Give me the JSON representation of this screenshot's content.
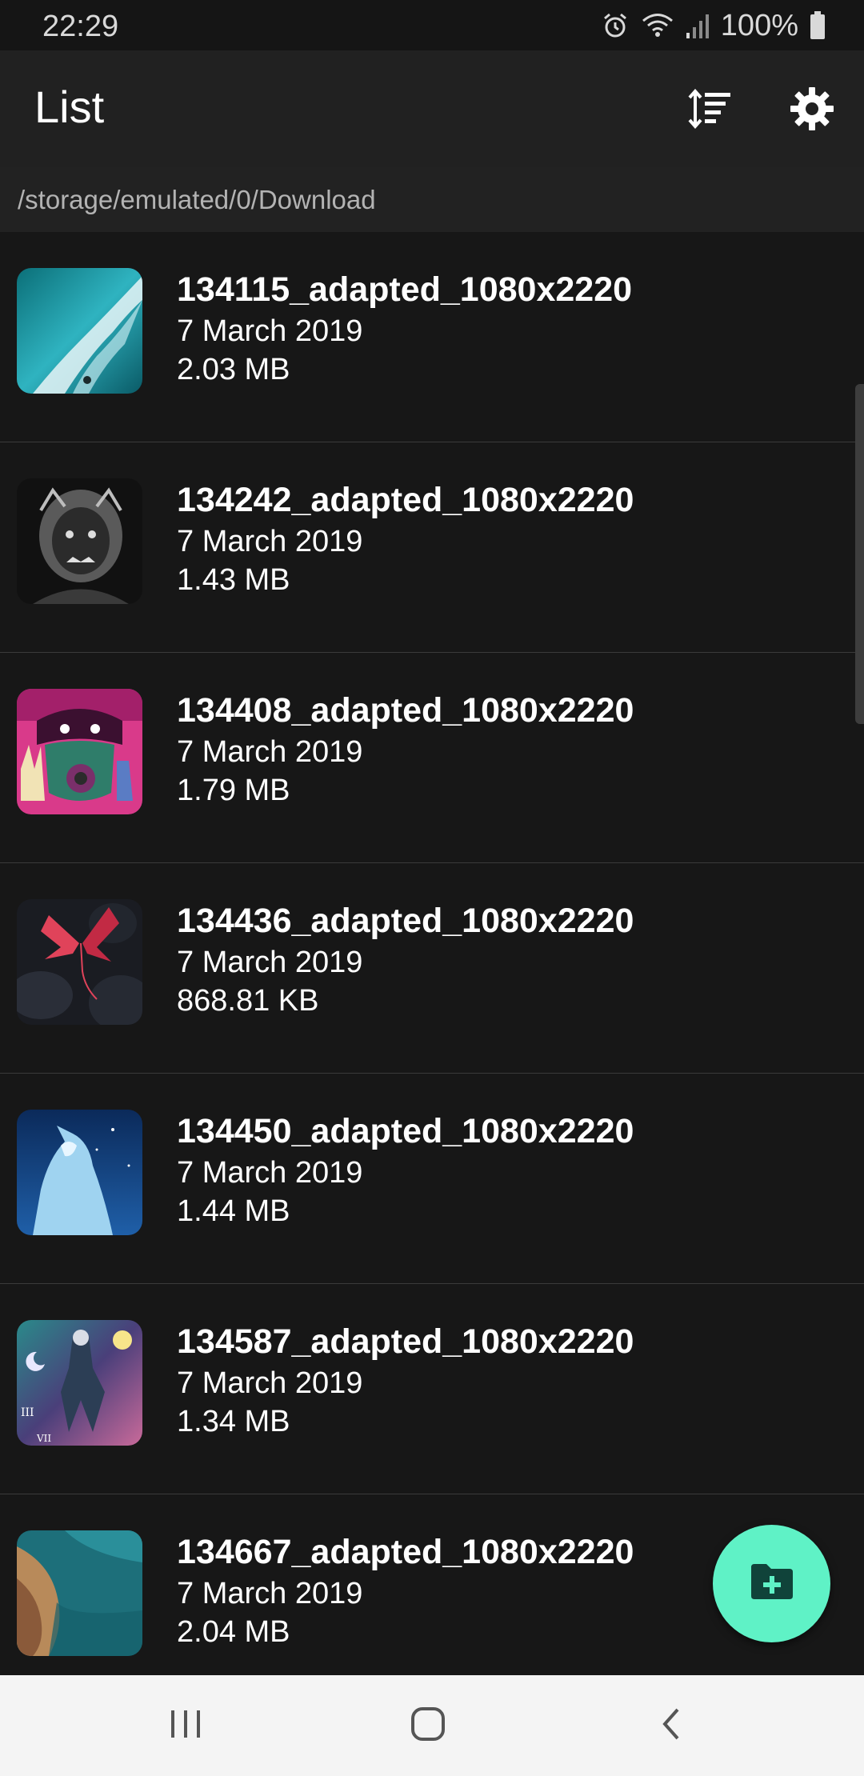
{
  "status_bar": {
    "time": "22:29",
    "battery": "100%",
    "icons": [
      "alarm-icon",
      "wifi-icon",
      "signal-icon",
      "battery-icon"
    ]
  },
  "app_bar": {
    "title": "List",
    "actions": [
      "sort-icon",
      "settings-gear-icon"
    ]
  },
  "path": "/storage/emulated/0/Download",
  "files": [
    {
      "name": "134115_adapted_1080x2220",
      "date": "7 March 2019",
      "size": "2.03 MB"
    },
    {
      "name": "134242_adapted_1080x2220",
      "date": "7 March 2019",
      "size": "1.43 MB"
    },
    {
      "name": "134408_adapted_1080x2220",
      "date": "7 March 2019",
      "size": "1.79 MB"
    },
    {
      "name": "134436_adapted_1080x2220",
      "date": "7 March 2019",
      "size": "868.81 KB"
    },
    {
      "name": "134450_adapted_1080x2220",
      "date": "7 March 2019",
      "size": "1.44 MB"
    },
    {
      "name": "134587_adapted_1080x2220",
      "date": "7 March 2019",
      "size": "1.34 MB"
    },
    {
      "name": "134667_adapted_1080x2220",
      "date": "7 March 2019",
      "size": "2.04 MB"
    }
  ],
  "fab": {
    "icon": "create-folder-icon"
  },
  "nav_bar": {
    "buttons": [
      "recent-apps-icon",
      "home-icon",
      "back-icon"
    ]
  },
  "colors": {
    "background": "#171717",
    "app_bar": "#212121",
    "accent": "#5ff2c6",
    "nav_bar": "#f4f4f4"
  }
}
